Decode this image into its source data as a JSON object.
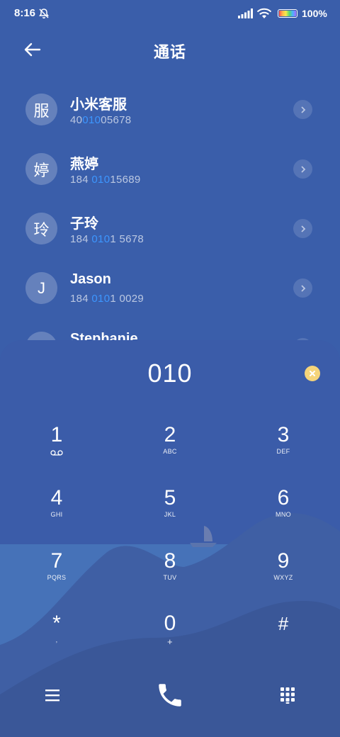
{
  "status": {
    "time": "8:16",
    "battery": "100%"
  },
  "header": {
    "title": "通话"
  },
  "contacts": [
    {
      "avatar": "服",
      "name": "小米客服",
      "num_pre": "40",
      "num_hl": "010",
      "num_post": "05678"
    },
    {
      "avatar": "婷",
      "name": "燕婷",
      "num_pre": "184 ",
      "num_hl": "010",
      "num_post": "15689"
    },
    {
      "avatar": "玲",
      "name": "子玲",
      "num_pre": "184 ",
      "num_hl": "010",
      "num_post": "1 5678"
    },
    {
      "avatar": "J",
      "name": "Jason",
      "num_pre": "184 ",
      "num_hl": "010",
      "num_post": "1 0029"
    },
    {
      "avatar": "S",
      "name": "Stephanie",
      "num_pre": "",
      "num_hl": "",
      "num_post": ""
    }
  ],
  "dialer": {
    "digits": "010",
    "keys": [
      {
        "d": "1",
        "l": ""
      },
      {
        "d": "2",
        "l": "ABC"
      },
      {
        "d": "3",
        "l": "DEF"
      },
      {
        "d": "4",
        "l": "GHI"
      },
      {
        "d": "5",
        "l": "JKL"
      },
      {
        "d": "6",
        "l": "MNO"
      },
      {
        "d": "7",
        "l": "PQRS"
      },
      {
        "d": "8",
        "l": "TUV"
      },
      {
        "d": "9",
        "l": "WXYZ"
      },
      {
        "d": "*",
        "l": ","
      },
      {
        "d": "0",
        "l": "+"
      },
      {
        "d": "#",
        "l": ""
      }
    ]
  },
  "colors": {
    "background": "#3a5eaa",
    "highlight": "#3d96ff",
    "clear_button": "#f5d47a"
  },
  "icons": {
    "back": "arrow-left-icon",
    "chevron": "chevron-right-icon",
    "clear": "clear-x-icon",
    "voicemail": "voicemail-icon",
    "menu": "menu-icon",
    "call": "phone-icon",
    "keypad": "keypad-icon"
  }
}
